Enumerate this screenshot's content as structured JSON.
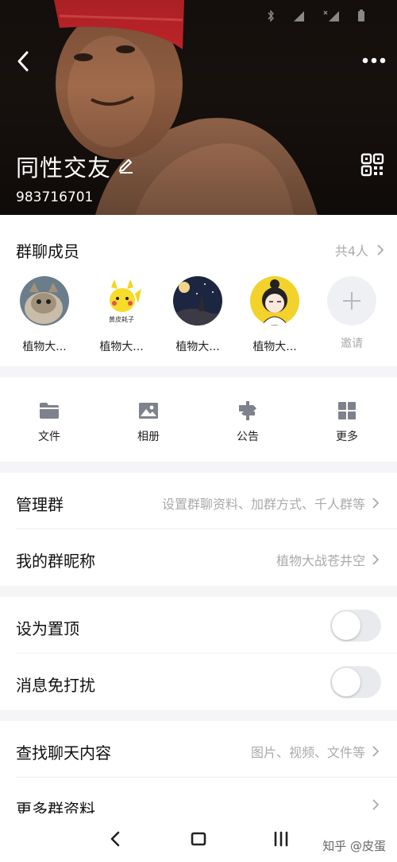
{
  "header": {
    "group_name": "同性交友",
    "group_id": "983716701"
  },
  "members": {
    "title": "群聊成员",
    "count_label": "共4人",
    "items": [
      {
        "name": "植物大..."
      },
      {
        "name": "植物大..."
      },
      {
        "name": "植物大..."
      },
      {
        "name": "植物大..."
      }
    ],
    "avatar_caption": "黄皮耗子",
    "invite_label": "邀请"
  },
  "tools": [
    {
      "label": "文件",
      "icon": "folder-icon"
    },
    {
      "label": "相册",
      "icon": "image-icon"
    },
    {
      "label": "公告",
      "icon": "signpost-icon"
    },
    {
      "label": "更多",
      "icon": "grid-icon"
    }
  ],
  "manage": {
    "manage_group_title": "管理群",
    "manage_group_value": "设置群聊资料、加群方式、千人群等",
    "nickname_title": "我的群昵称",
    "nickname_value": "植物大战苍井空"
  },
  "toggles": {
    "pin_title": "设为置顶",
    "pin_on": false,
    "mute_title": "消息免打扰",
    "mute_on": false
  },
  "search": {
    "find_title": "查找聊天内容",
    "find_value": "图片、视频、文件等",
    "more_info_title": "更多群资料"
  },
  "navbar": {
    "watermark": "知乎 @皮蛋"
  },
  "colors": {
    "accent_gray": "#aaaaaa",
    "icon_gray": "#7d828c",
    "toggle_off": "#e9eaee"
  }
}
